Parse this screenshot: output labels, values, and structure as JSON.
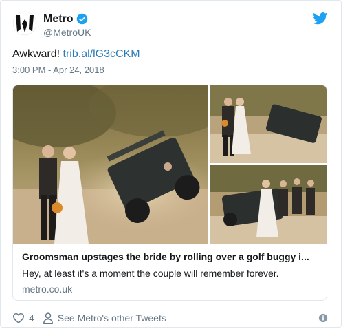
{
  "account": {
    "display_name": "Metro",
    "handle": "@MetroUK"
  },
  "tweet": {
    "text_prefix": "Awkward! ",
    "link_text": "trib.al/lG3cCKM",
    "timestamp": "3:00 PM - Apr 24, 2018"
  },
  "card": {
    "title": "Groomsman upstages the bride by rolling over a golf buggy i...",
    "description": "Hey, at least it's a moment the couple will remember forever.",
    "domain": "metro.co.uk"
  },
  "footer": {
    "like_count": "4",
    "other_tweets_label": "See Metro's other Tweets"
  },
  "colors": {
    "link": "#2b7bb9",
    "twitter_blue": "#1da1f2",
    "muted": "#657786",
    "border": "#e1e8ed"
  },
  "icons": [
    "metro-logo-icon",
    "verified-badge-icon",
    "twitter-bird-icon",
    "heart-icon",
    "person-icon",
    "info-icon"
  ]
}
